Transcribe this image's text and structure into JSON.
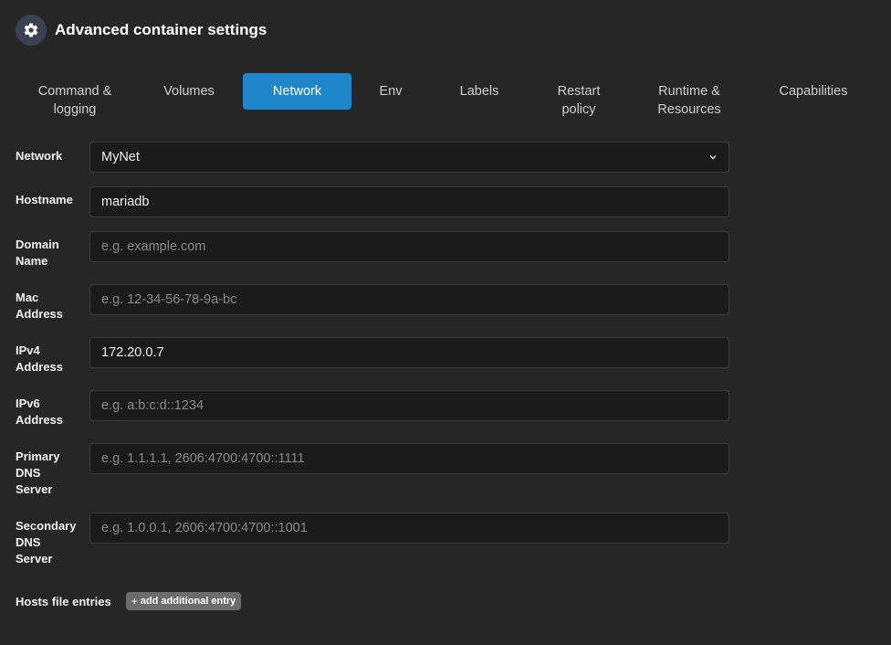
{
  "header": {
    "title": "Advanced container settings",
    "icon": "gear-icon"
  },
  "tabs": [
    {
      "label": "Command &\nlogging",
      "active": false
    },
    {
      "label": "Volumes",
      "active": false
    },
    {
      "label": "Network",
      "active": true
    },
    {
      "label": "Env",
      "active": false
    },
    {
      "label": "Labels",
      "active": false
    },
    {
      "label": "Restart\npolicy",
      "active": false
    },
    {
      "label": "Runtime &\nResources",
      "active": false
    },
    {
      "label": "Capabilities",
      "active": false
    }
  ],
  "form": {
    "network": {
      "label": "Network",
      "value": "MyNet"
    },
    "hostname": {
      "label": "Hostname",
      "value": "mariadb",
      "placeholder": ""
    },
    "domain_name": {
      "label": "Domain Name",
      "value": "",
      "placeholder": "e.g. example.com"
    },
    "mac_address": {
      "label": "Mac Address",
      "value": "",
      "placeholder": "e.g. 12-34-56-78-9a-bc"
    },
    "ipv4_address": {
      "label": "IPv4 Address",
      "value": "172.20.0.7",
      "placeholder": ""
    },
    "ipv6_address": {
      "label": "IPv6 Address",
      "value": "",
      "placeholder": "e.g. a:b:c:d::1234"
    },
    "primary_dns": {
      "label": "Primary DNS Server",
      "value": "",
      "placeholder": "e.g. 1.1.1.1, 2606:4700:4700::1111"
    },
    "secondary_dns": {
      "label": "Secondary DNS Server",
      "value": "",
      "placeholder": "e.g. 1.0.0.1, 2606:4700:4700::1001"
    }
  },
  "hosts": {
    "label": "Hosts file entries",
    "add_button_label": "add additional entry",
    "add_button_icon": "plus-icon"
  },
  "colors": {
    "background": "#262626",
    "accent": "#1f87c9",
    "input_bg": "#1b1b1b",
    "button_gray": "#6c6c6c"
  }
}
